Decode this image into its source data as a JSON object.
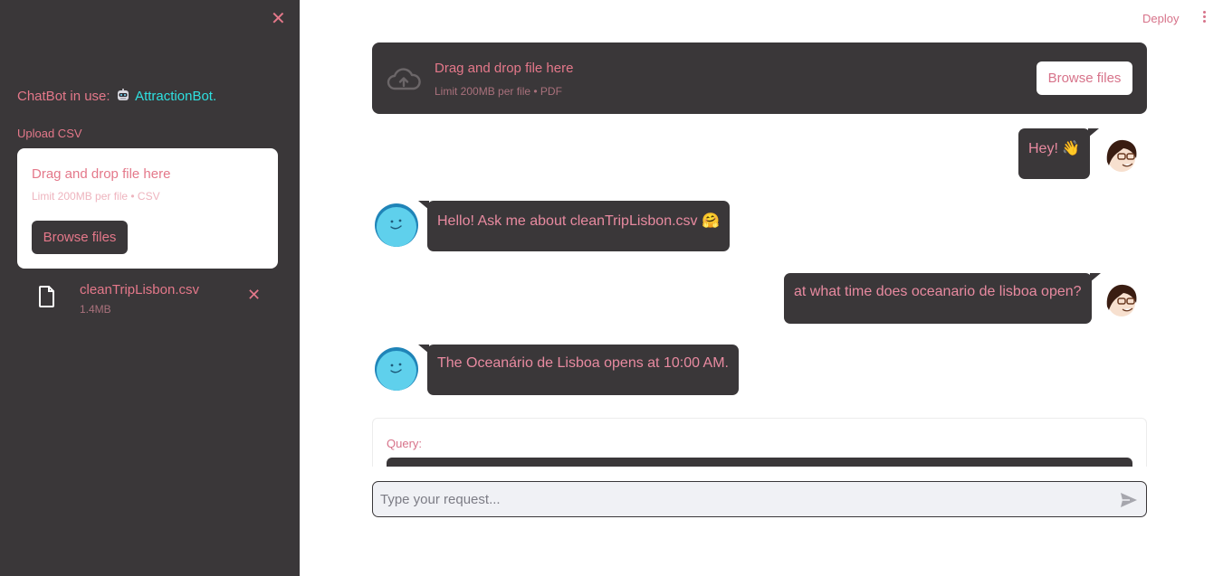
{
  "sidebar": {
    "close_icon": "close-icon",
    "chatbot_prefix": "ChatBot in use:",
    "bot_icon": "robot-icon",
    "bot_name": "AttractionBot.",
    "upload_label": "Upload CSV",
    "dropzone": {
      "title": "Drag and drop file here",
      "limit": "Limit 200MB per file • CSV",
      "browse_label": "Browse files"
    },
    "file": {
      "name": "cleanTripLisbon.csv",
      "size": "1.4MB"
    }
  },
  "header": {
    "deploy_label": "Deploy"
  },
  "main_dropzone": {
    "title": "Drag and drop file here",
    "limit": "Limit 200MB per file • PDF",
    "browse_label": "Browse files"
  },
  "messages": [
    {
      "role": "user",
      "text": "Hey! 👋"
    },
    {
      "role": "assistant",
      "text": "Hello! Ask me about cleanTripLisbon.csv 🤗"
    },
    {
      "role": "user",
      "text": "at what time does oceanario de lisboa open?"
    },
    {
      "role": "assistant",
      "text": "The Oceanário de Lisboa opens at 10:00 AM."
    }
  ],
  "query_card": {
    "label": "Query:"
  },
  "chat_input": {
    "placeholder": "Type your request..."
  },
  "colors": {
    "sidebar_bg": "#3a3739",
    "accent_pink": "#e4788a",
    "bot_name": "#2ee0e0",
    "bubble_bg": "#3a3739"
  }
}
